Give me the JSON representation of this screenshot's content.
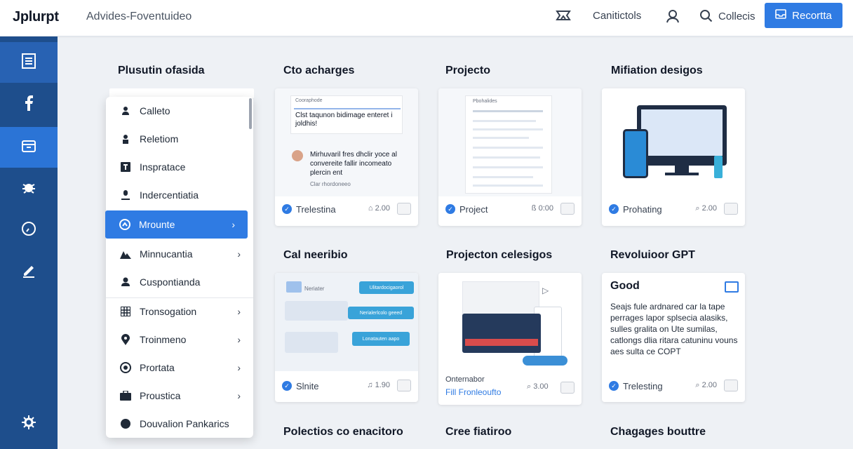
{
  "header": {
    "logo": "Jplurpt",
    "breadcrumb": "Advides-Foventuideo",
    "contacts_label": "Canitictols",
    "search_label": "Collecis",
    "primary_button": "Recortta"
  },
  "menu": {
    "items": [
      {
        "label": "Calleto"
      },
      {
        "label": "Reletiom"
      },
      {
        "label": "Inspratace"
      },
      {
        "label": "Indercentiatia"
      },
      {
        "label": "Mrounte"
      },
      {
        "label": "Minnucantia"
      },
      {
        "label": "Cuspontianda"
      },
      {
        "label": "Tronsogation"
      },
      {
        "label": "Troinmeno"
      },
      {
        "label": "Prortata"
      },
      {
        "label": "Proustica"
      },
      {
        "label": "Douvalion Pankarics"
      }
    ]
  },
  "sections": {
    "s1": "Plusutin ofasida",
    "s2": "Cto acharges",
    "s3": "Projecto",
    "s4": "Mifiation desigos",
    "s5": "Cal neeribio",
    "s6": "Projecton celesigos",
    "s7": "Revoluioor GPT",
    "s8": "Polectios co enacitoro",
    "s9": "Cree fiatiroo",
    "s10": "Chagages bouttre"
  },
  "cards": {
    "c1": {
      "preview_header": "Cooraphode",
      "preview_title": "Clst taqunon bidimage enteret i joldhis!",
      "preview_body": "Mirhuvaril fres dhclir yoce al convereite fallir incomeato plercin ent",
      "preview_tail": "Clar rhordoneeo",
      "footer": "Trelestina",
      "meta": "2.00"
    },
    "c2": {
      "preview_header": "Pbohalides",
      "footer": "Project",
      "meta": "0:00"
    },
    "c3": {
      "footer": "Prohating",
      "meta": "2.00"
    },
    "c4": {
      "preview_label": "Neriater",
      "bubble1": "Ulitardocigaorol",
      "bubble2": "Nerialerlcolo geeed",
      "bubble3": "Lonatauten aapo",
      "footer": "Slnite",
      "meta": "1.90"
    },
    "c5": {
      "caption": "Onternabor",
      "link": "Fill Fronleoufto",
      "meta": "3.00"
    },
    "c6": {
      "title": "Good",
      "body": "Seajs fule ardnared car la tape perrages lapor splsecia alasiks, sulles gralita on Ute sumilas, catlongs dlia ritara catuninu vouns aes sulta ce COPT",
      "footer": "Trelesting",
      "meta": "2.00"
    }
  },
  "colors": {
    "accent": "#2f7be3",
    "rail": "#1e4e8c",
    "rail_active": "#2b74d6"
  }
}
